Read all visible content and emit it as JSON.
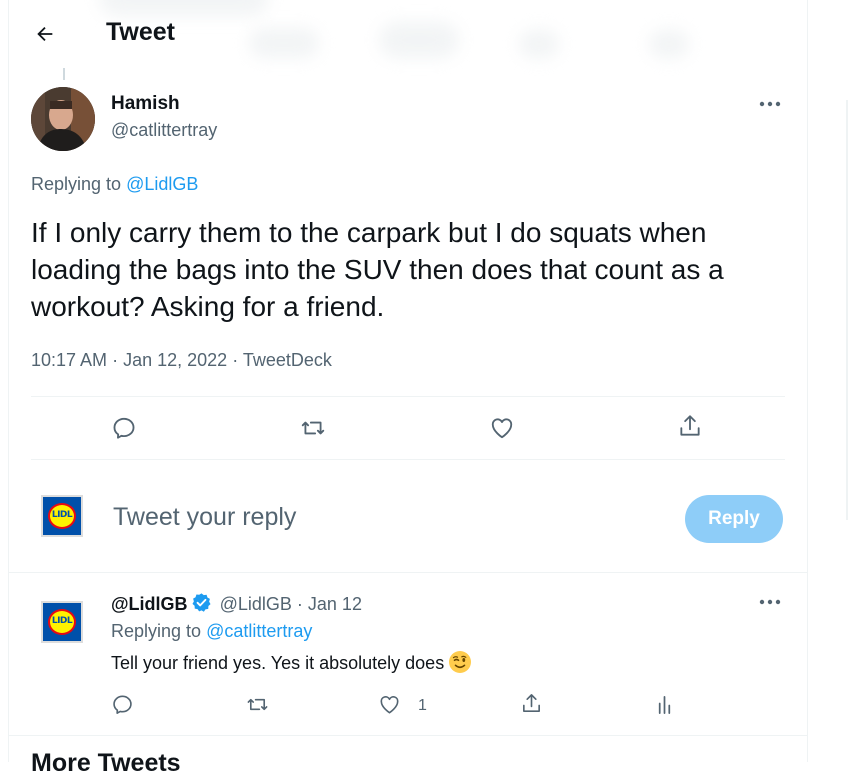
{
  "header": {
    "title": "Tweet"
  },
  "tweet": {
    "author_name": "Hamish",
    "author_handle": "@catlittertray",
    "replying_prefix": "Replying to",
    "replying_handle": "@LidlGB",
    "text": "If I only carry them to the carpark but I do squats when loading the bags into the SUV then does that count as a workout?  Asking for a friend.",
    "time": "10:17 AM",
    "date": "Jan 12, 2022",
    "source": "TweetDeck",
    "separator": "·"
  },
  "composer": {
    "avatar_text": "LIDL",
    "placeholder": "Tweet your reply",
    "button_label": "Reply"
  },
  "reply": {
    "author_name": "@LidlGB",
    "author_handle": "@LidlGB",
    "date": "Jan 12",
    "separator": "·",
    "replying_prefix": "Replying to",
    "replying_handle": "@catlittertray",
    "text": "Tell your friend yes. Yes it absolutely does",
    "like_count": "1",
    "avatar_text": "LIDL"
  },
  "section": {
    "more_tweets": "More Tweets"
  },
  "colors": {
    "accent": "#1d9bf0",
    "reply_button": "#8ecdf8",
    "secondary_text": "#536471"
  },
  "icons": [
    "back-arrow-icon",
    "more-icon",
    "reply-icon",
    "retweet-icon",
    "like-icon",
    "share-icon",
    "analytics-icon",
    "verified-badge-icon",
    "winking-face-emoji"
  ]
}
